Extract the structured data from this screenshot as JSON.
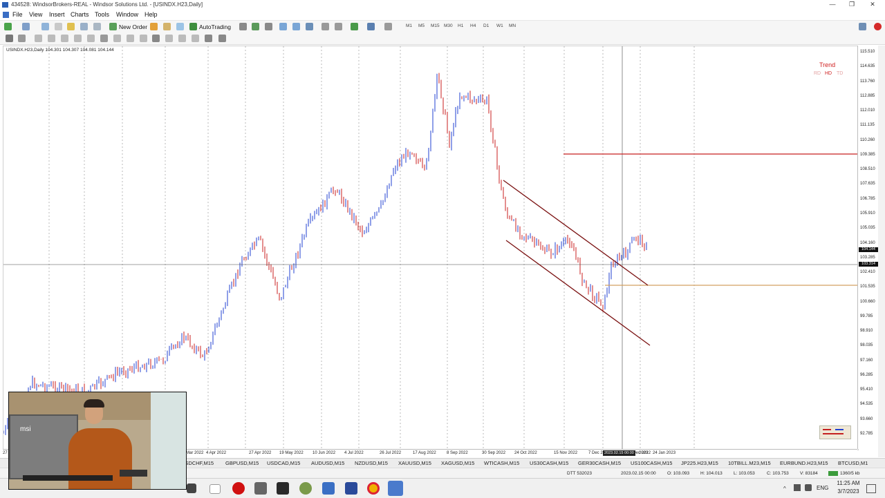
{
  "window": {
    "title": "434528: WindsorBrokers-REAL - Windsor Solutions Ltd. - [USINDX.H23,Daily]",
    "controls": [
      "—",
      "❐",
      "✕"
    ]
  },
  "menu": [
    "File",
    "View",
    "Insert",
    "Charts",
    "Tools",
    "Window",
    "Help"
  ],
  "toolbar": {
    "new_order": "New Order",
    "auto_trading": "AutoTrading",
    "timeframes": [
      "M1",
      "M5",
      "M15",
      "M30",
      "H1",
      "H4",
      "D1",
      "W1",
      "MN"
    ]
  },
  "chart": {
    "header": "USINDX.H23,Daily  104.301 104.307 104.081 104.144",
    "panel": {
      "title": "Trend",
      "items": [
        "RD",
        "HD",
        "TD"
      ]
    },
    "colors": {
      "bull": "#1f3fd0",
      "bear": "#c81e1e",
      "channel": "#7a1010",
      "resistance": "#c81e1e",
      "support": "#d2a060"
    },
    "price_levels": [
      "115.510",
      "114.635",
      "113.760",
      "112.885",
      "112.010",
      "111.135",
      "110.260",
      "109.385",
      "108.510",
      "107.635",
      "106.785",
      "105.910",
      "105.035",
      "104.160",
      "103.285",
      "102.410",
      "101.535",
      "100.660",
      "99.785",
      "98.910",
      "98.035",
      "97.160",
      "96.285",
      "95.410",
      "94.535",
      "93.660",
      "92.785"
    ],
    "current_price": "104.144",
    "crosshair_price": "103.314",
    "dates": [
      "27 Dec 2021",
      "4 Mar 2022",
      "4 Apr 2022",
      "27 Apr 2022",
      "19 May 2022",
      "10 Jun 2022",
      "4 Jul 2022",
      "26 Jul 2022",
      "17 Aug 2022",
      "8 Sep 2022",
      "30 Sep 2022",
      "24 Oct 2022",
      "15 Nov 2022",
      "7 Dec 2022",
      "30 Dec 2022",
      "24 Jan 2023"
    ],
    "crosshair_date": "2023.02.15 00:00",
    "date_tail": "2023"
  },
  "tabs": [
    "USDCHF,M15",
    "GBPUSD,M15",
    "USDCAD,M15",
    "AUDUSD,M15",
    "NZDUSD,M15",
    "XAUUSD,M15",
    "XAGUSD,M15",
    "WTICASH,M15",
    "US30CASH,M15",
    "GER30CASH,M15",
    "US100CASH,M15",
    "JP225.H23,M15",
    "10TBILL.M23,M15",
    "EURBUND.H23,M15",
    "BTCUSD,M1"
  ],
  "statusbar": {
    "profile": "DTT 532023",
    "datetime": "2023.02.15 00:00",
    "open": "O: 103.093",
    "high": "H: 104.013",
    "low": "L: 103.053",
    "close": "C: 103.753",
    "volume": "V: 83184",
    "traffic": "1360/5 kb"
  },
  "taskbar": {
    "language": "ENG",
    "time": "11:25 AM",
    "date": "3/7/2023"
  },
  "webcam": {
    "monitor_brand": "msi"
  }
}
